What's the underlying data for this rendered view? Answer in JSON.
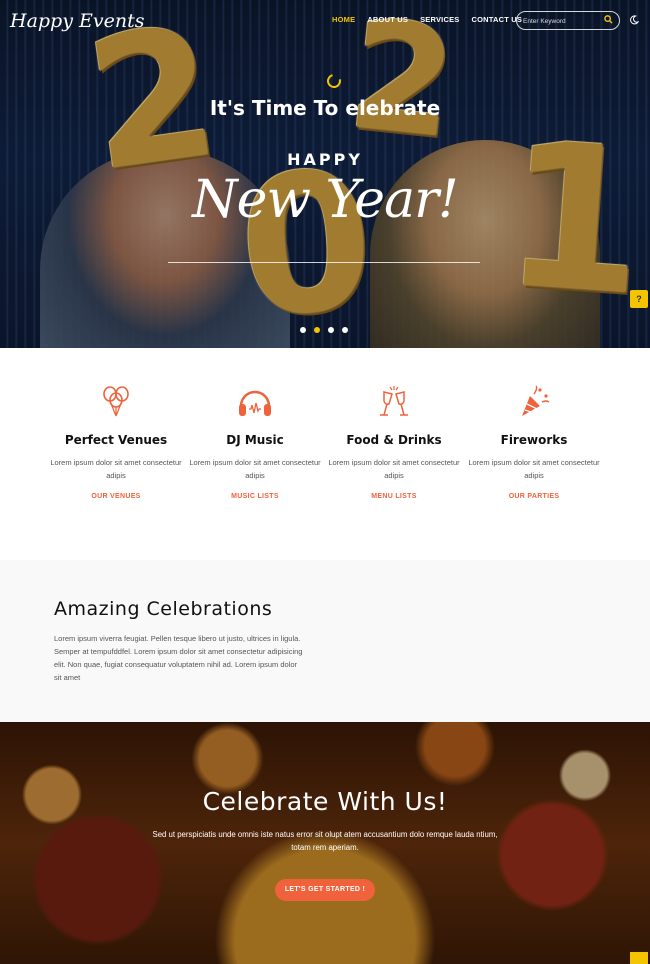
{
  "nav": {
    "logo": "Happy Events",
    "menu": [
      {
        "label": "HOME",
        "active": true
      },
      {
        "label": "ABOUT US",
        "active": false
      },
      {
        "label": "SERVICES",
        "active": false
      },
      {
        "label": "CONTACT US",
        "active": false
      }
    ],
    "search_placeholder": "Enter Keyword",
    "accent_color": "#f5c400"
  },
  "hero": {
    "title": "It's Time To  elebrate",
    "happy": "HAPPY",
    "new_year": "New Year!",
    "balloon_digits": [
      "2",
      "2",
      "0",
      "1"
    ],
    "slide_dots": 4,
    "active_dot": 2
  },
  "features": [
    {
      "icon": "balloons-icon",
      "title": "Perfect Venues",
      "desc": "Lorem ipsum dolor sit amet consectetur adipis",
      "link": "OUR VENUES"
    },
    {
      "icon": "headphones-icon",
      "title": "DJ Music",
      "desc": "Lorem ipsum dolor sit amet consectetur adipis",
      "link": "MUSIC LISTS"
    },
    {
      "icon": "champagne-icon",
      "title": "Food & Drinks",
      "desc": "Lorem ipsum dolor sit amet consectetur adipis",
      "link": "MENU LISTS"
    },
    {
      "icon": "party-popper-icon",
      "title": "Fireworks",
      "desc": "Lorem ipsum dolor sit amet consectetur adipis",
      "link": "OUR PARTIES"
    }
  ],
  "about": {
    "title": "Amazing Celebrations",
    "text": "Lorem ipsum viverra feugiat. Pellen tesque libero ut justo, ultrices in ligula. Semper at tempufddfel. Lorem ipsum dolor sit amet consectetur adipisicing elit. Non quae, fugiat consequatur voluptatem nihil ad. Lorem ipsum dolor sit amet"
  },
  "cta": {
    "title": "Celebrate With Us!",
    "text": "Sed ut perspiciatis unde omnis iste natus error sit olupt atem accusantium dolo remque lauda ntium, totam rem aperiam.",
    "button": "LET'S GET STARTED !",
    "button_color": "#f0623c"
  }
}
